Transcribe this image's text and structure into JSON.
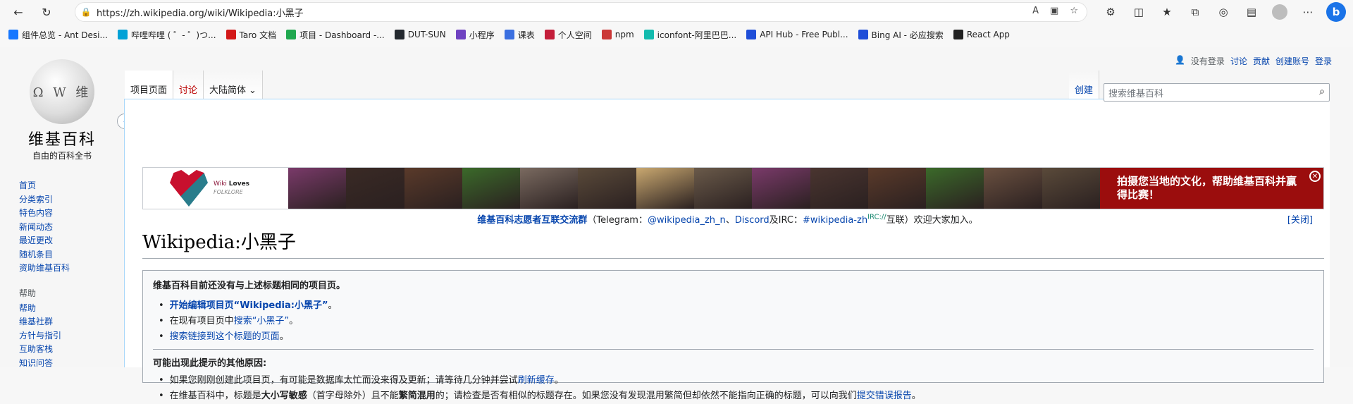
{
  "browser": {
    "url": "https://zh.wikipedia.org/wiki/Wikipedia:小黑子",
    "bookmarks": [
      {
        "label": "组件总览 - Ant Desi...",
        "color": "#1677ff"
      },
      {
        "label": "哔哩哔哩 ( ゜- ゜)つ...",
        "color": "#00a1d6"
      },
      {
        "label": "Taro 文档",
        "color": "#d31919"
      },
      {
        "label": "项目 - Dashboard -...",
        "color": "#20a84f"
      },
      {
        "label": "DUT-SUN",
        "color": "#24292f"
      },
      {
        "label": "小程序",
        "color": "#6f42c1"
      },
      {
        "label": "课表",
        "color": "#3b6fe0"
      },
      {
        "label": "个人空间",
        "color": "#c41e3a"
      },
      {
        "label": "npm",
        "color": "#cb3837"
      },
      {
        "label": "iconfont-阿里巴巴...",
        "color": "#13bbae"
      },
      {
        "label": "API Hub - Free Publ...",
        "color": "#1f4ed8"
      },
      {
        "label": "Bing AI - 必应搜索",
        "color": "#1f4ed8"
      },
      {
        "label": "React App",
        "color": "#222222"
      }
    ]
  },
  "logo": {
    "title": "维基百科",
    "subtitle": "自由的百科全书",
    "glyphs": "Ω W 维"
  },
  "sidebar": {
    "main": [
      "首页",
      "分类索引",
      "特色内容",
      "新闻动态",
      "最近更改",
      "随机条目",
      "资助维基百科"
    ],
    "help_heading": "帮助",
    "help": [
      "帮助",
      "维基社群",
      "方针与指引",
      "互助客栈",
      "知识问答"
    ]
  },
  "personal": {
    "user": "没有登录",
    "links": [
      "讨论",
      "贡献",
      "创建账号",
      "登录"
    ]
  },
  "tabs": {
    "page": "项目页面",
    "talk": "讨论",
    "variant": "大陆简体",
    "create": "创建"
  },
  "search": {
    "placeholder": "搜索维基百科"
  },
  "banner": {
    "logo_line1": "Wiki",
    "logo_line2": "Loves",
    "logo_line3": "FOLKLORE",
    "message": "拍摄您当地的文化，帮助维基百科并赢得比赛！",
    "photo_colors": [
      "#7a3a6a",
      "#3a2a25",
      "#5a3a2a",
      "#3b6a2a",
      "#7a6a60",
      "#5a4a3a",
      "#c9a870",
      "#6a5a4a",
      "#7a3a6a",
      "#4a3530",
      "#5a3a2a",
      "#3b6a2a",
      "#6a5040",
      "#5a4a3a"
    ]
  },
  "sitenotice": {
    "group": "维基百科志愿者互联交流群",
    "telegram_prefix": "（Telegram：",
    "telegram": "@wikipedia_zh_n",
    "sep": "、",
    "discord": "Discord",
    "irc_prefix": "及IRC：",
    "irc": "#wikipedia-zh",
    "irc_sup": "IRC://",
    "suffix": "互联）欢迎大家加入。",
    "close": "[关闭]"
  },
  "title": "Wikipedia:小黑子",
  "notice": {
    "lead": "维基百科目前还没有与上述标题相同的项目页。",
    "items": [
      {
        "link": "开始编辑项目页“Wikipedia:小黑子”",
        "tail": "。",
        "bold": true
      },
      {
        "pre": "在现有项目页中",
        "link": "搜索“小黑子”",
        "tail": "。"
      },
      {
        "link": "搜索链接到这个标题的页面",
        "tail": "。"
      }
    ],
    "reasons_heading": "可能出现此提示的其他原因:",
    "reasons": [
      {
        "text": "如果您刚刚创建此项目页，有可能是数据库太忙而没来得及更新；请等待几分钟并尝试",
        "link": "刷新缓存",
        "tail": "。"
      },
      {
        "pre": "在维基百科中，标题是",
        "b1": "大小写敏感",
        "mid": "（首字母除外）且不能",
        "b2": "繁简混用",
        "text": "的；请检查是否有相似的标题存在。如果您没有发现混用繁简但却依然不能指向正确的标题，可以向我们",
        "link": "提交错误报告",
        "tail": "。"
      }
    ]
  }
}
